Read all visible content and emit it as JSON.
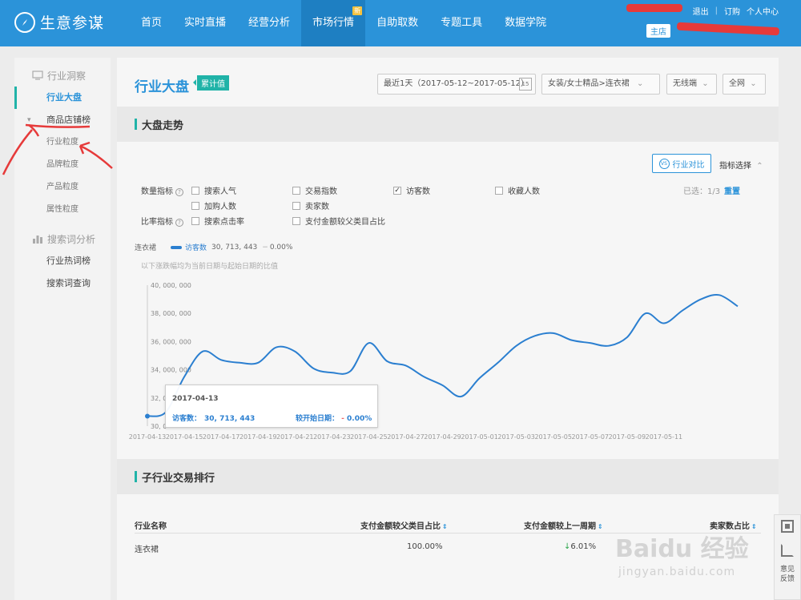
{
  "brand": {
    "name": "生意参谋"
  },
  "nav": {
    "items": [
      "首页",
      "实时直播",
      "经营分析",
      "市场行情",
      "自助取数",
      "专题工具",
      "数据学院"
    ],
    "active_index": 3,
    "new_badge": "新"
  },
  "topbar": {
    "logout": "退出",
    "divider": "|",
    "orders": "订购",
    "personal_center": "个人中心",
    "store_tag": "主店"
  },
  "sidebar": {
    "section1": "行业洞察",
    "items1": [
      "行业大盘",
      "商品店铺榜",
      "行业粒度",
      "品牌粒度",
      "产品粒度",
      "属性粒度"
    ],
    "section2": "搜索词分析",
    "items2": [
      "行业热词榜",
      "搜索词查询"
    ]
  },
  "main": {
    "title": "行业大盘",
    "acc_tag": "累计值",
    "date_filter": "最近1天（2017-05-12~2017-05-12）",
    "cal_label": "15",
    "category_filter": "女装/女士精品>连衣裙",
    "terminal_filter": "无线端",
    "region_filter": "全网"
  },
  "trend": {
    "title": "大盘走势",
    "vs_label": "行业对比",
    "vs_icon": "VS",
    "metric_select": "指标选择",
    "metric_group_label": "数量指标",
    "ratio_group_label": "比率指标",
    "metrics": [
      "搜索人气",
      "交易指数",
      "访客数",
      "收藏人数",
      "加购人数",
      "卖家数"
    ],
    "ratios": [
      "搜索点击率",
      "支付金额较父类目占比"
    ],
    "checked": "访客数",
    "checkmark": "✓",
    "selected_count": "已选：1/3",
    "reset": "重置",
    "legend_category": "连衣裙",
    "legend_series": "访客数",
    "legend_value": "30, 713, 443",
    "legend_change": "0.00%",
    "note": "以下涨跌幅均为当前日期与起始日期的比值"
  },
  "tooltip": {
    "date": "2017-04-13",
    "metric_label": "访客数：",
    "metric_value": "30, 713, 443",
    "change_label": "较开始日期：",
    "change_flat": "-",
    "change_value": "0.00%"
  },
  "chart_data": {
    "type": "line",
    "series": [
      {
        "name": "访客数",
        "values": [
          30713443,
          31000000,
          33500000,
          35300000,
          34700000,
          34500000,
          34500000,
          35600000,
          35300000,
          34100000,
          33800000,
          33900000,
          35900000,
          34600000,
          34300000,
          33500000,
          32900000,
          32100000,
          33400000,
          34500000,
          35700000,
          36400000,
          36600000,
          36100000,
          35900000,
          35700000,
          36300000,
          38000000,
          37300000,
          38200000,
          39000000,
          39300000,
          38500000
        ]
      }
    ],
    "x": [
      "2017-04-13",
      "2017-04-14",
      "2017-04-15",
      "2017-04-16",
      "2017-04-17",
      "2017-04-18",
      "2017-04-19",
      "2017-04-20",
      "2017-04-21",
      "2017-04-22",
      "2017-04-23",
      "2017-04-24",
      "2017-04-25",
      "2017-04-26",
      "2017-04-27",
      "2017-04-28",
      "2017-04-29",
      "2017-04-30",
      "2017-05-01",
      "2017-05-02",
      "2017-05-03",
      "2017-05-04",
      "2017-05-05",
      "2017-05-06",
      "2017-05-07",
      "2017-05-08",
      "2017-05-09",
      "2017-05-10",
      "2017-05-11",
      "2017-05-12",
      "2017-05-13",
      "2017-05-14",
      "2017-05-15"
    ],
    "x_tick_labels": [
      "2017-04-13",
      "2017-04-15",
      "2017-04-17",
      "2017-04-19",
      "2017-04-21",
      "2017-04-23",
      "2017-04-25",
      "2017-04-27",
      "2017-04-29",
      "2017-05-01",
      "2017-05-03",
      "2017-05-05",
      "2017-05-07",
      "2017-05-09",
      "2017-05-11"
    ],
    "y_tick_labels": [
      "40, 000, 000",
      "38, 000, 000",
      "36, 000, 000",
      "34, 000, 000",
      "32, 0",
      "30, 0"
    ],
    "y_tick_values": [
      40000000,
      38000000,
      36000000,
      34000000,
      32000000,
      30000000
    ],
    "ylim": [
      30000000,
      40000000
    ],
    "grid": false,
    "line_color": "#2b7fd0"
  },
  "sub_industry": {
    "title": "子行业交易排行",
    "headers": [
      "行业名称",
      "支付金额较父类目占比",
      "支付金额较上一周期",
      "卖家数占比"
    ],
    "sort_icon": "⇕",
    "rows": [
      {
        "name": "连衣裙",
        "share": "100.00%",
        "arrow": "↓",
        "change": "6.01%"
      }
    ]
  },
  "float_tools": {
    "feedback": "意见反馈"
  },
  "watermark": {
    "main": "Baidu 经验",
    "url": "jingyan.baidu.com"
  }
}
